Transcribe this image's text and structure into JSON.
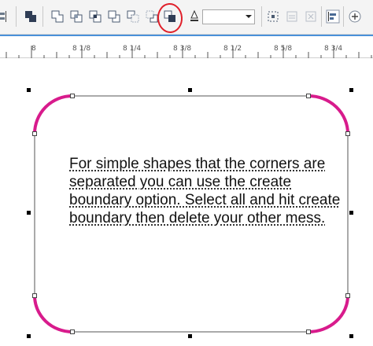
{
  "toolbar": {
    "tools": [
      {
        "name": "align-distribute-icon"
      },
      {
        "name": "combine-icon"
      },
      {
        "name": "weld-icon"
      },
      {
        "name": "trim-icon"
      },
      {
        "name": "intersect-icon"
      },
      {
        "name": "simplify-icon"
      },
      {
        "name": "front-minus-back-icon"
      },
      {
        "name": "back-minus-front-icon"
      },
      {
        "name": "create-boundary-icon"
      },
      {
        "name": "outline-pen-icon"
      }
    ],
    "outline_width_value": "",
    "highlight_color": "#e0202a"
  },
  "ruler": {
    "labels": [
      "8",
      "8 1/8",
      "8 1/4",
      "8 3/8",
      "8 1/2",
      "8 5/8",
      "8 3/4"
    ]
  },
  "canvas": {
    "text": "For simple shapes that the corners are separated you can use the create boundary option. Select all and hit create boundary then delete your other mess.",
    "corner_color": "#d81b8c"
  }
}
